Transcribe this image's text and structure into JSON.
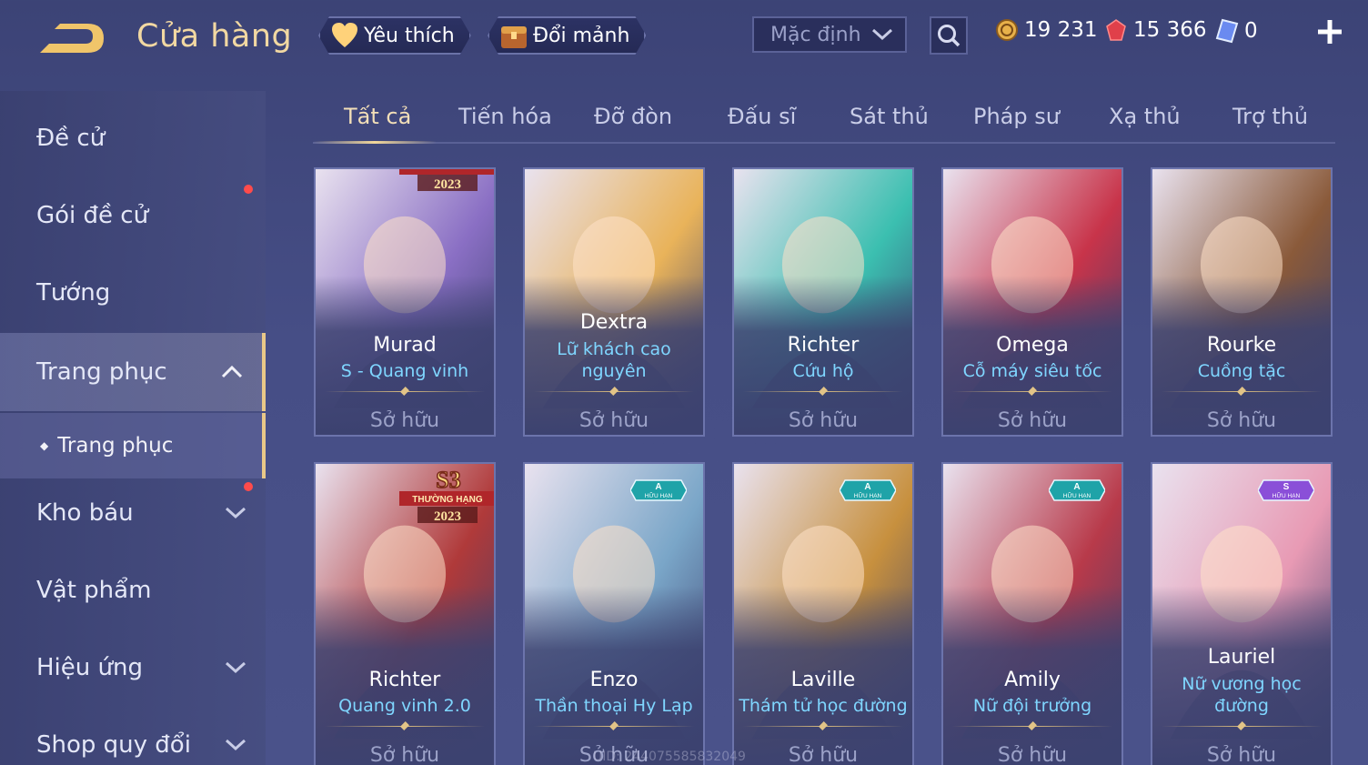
{
  "header": {
    "title": "Cửa hàng",
    "favorite_label": "Yêu thích",
    "exchange_label": "Đổi mảnh",
    "sort_value": "Mặc định",
    "currencies": [
      {
        "icon": "gold-coin-icon",
        "value": "19 231"
      },
      {
        "icon": "red-gem-icon",
        "value": "15 366"
      },
      {
        "icon": "voucher-icon",
        "value": "0"
      }
    ]
  },
  "sidebar": {
    "items": [
      {
        "label": "Đề cử"
      },
      {
        "label": "Gói đề cử"
      },
      {
        "label": "Tướng"
      },
      {
        "label": "Trang phục"
      },
      {
        "label": "Trang phục"
      },
      {
        "label": "Kho báu"
      },
      {
        "label": "Vật phẩm"
      },
      {
        "label": "Hiệu ứng"
      },
      {
        "label": "Shop quy đổi"
      }
    ]
  },
  "tabs": [
    "Tất cả",
    "Tiến hóa",
    "Đỡ đòn",
    "Đấu sĩ",
    "Sát thủ",
    "Pháp sư",
    "Xạ thủ",
    "Trợ thủ"
  ],
  "cards": [
    {
      "hero": "Murad",
      "skin": "S - Quang vinh",
      "status": "Sở hữu",
      "badge_text": "2023",
      "accent": "#8a6fc4"
    },
    {
      "hero": "Dextra",
      "skin": "Lữ khách cao nguyên",
      "status": "Sở hữu",
      "accent": "#e9b35a"
    },
    {
      "hero": "Richter",
      "skin": "Cứu hộ",
      "status": "Sở hữu",
      "accent": "#3bbfb0"
    },
    {
      "hero": "Omega",
      "skin": "Cỗ máy siêu tốc",
      "status": "Sở hữu",
      "accent": "#c8344a"
    },
    {
      "hero": "Rourke",
      "skin": "Cuồng tặc",
      "status": "Sở hữu",
      "accent": "#8a5a3a"
    },
    {
      "hero": "Richter",
      "skin": "Quang vinh 2.0",
      "status": "Sở hữu",
      "badge_top": "S3",
      "badge_mid": "THƯỜNG HẠNG",
      "badge_text": "2023",
      "accent": "#b03a3a"
    },
    {
      "hero": "Enzo",
      "skin": "Thần thoại Hy Lạp",
      "status": "Sở hữu",
      "tier": "A",
      "tier_sub": "HỮU HẠN",
      "accent": "#7aa6c8"
    },
    {
      "hero": "Laville",
      "skin": "Thám tử học đường",
      "status": "Sở hữu",
      "tier": "A",
      "tier_sub": "HỮU HẠN",
      "accent": "#c7903e"
    },
    {
      "hero": "Amily",
      "skin": "Nữ đội trưởng",
      "status": "Sở hữu",
      "tier": "A",
      "tier_sub": "HỮU HẠN",
      "accent": "#b83a4a"
    },
    {
      "hero": "Lauriel",
      "skin": "Nữ vương học đường",
      "status": "Sở hữu",
      "tier": "S",
      "tier_sub": "HỮU HẠN",
      "accent": "#e89ab4"
    }
  ],
  "uid": "UID: 244075585832049"
}
